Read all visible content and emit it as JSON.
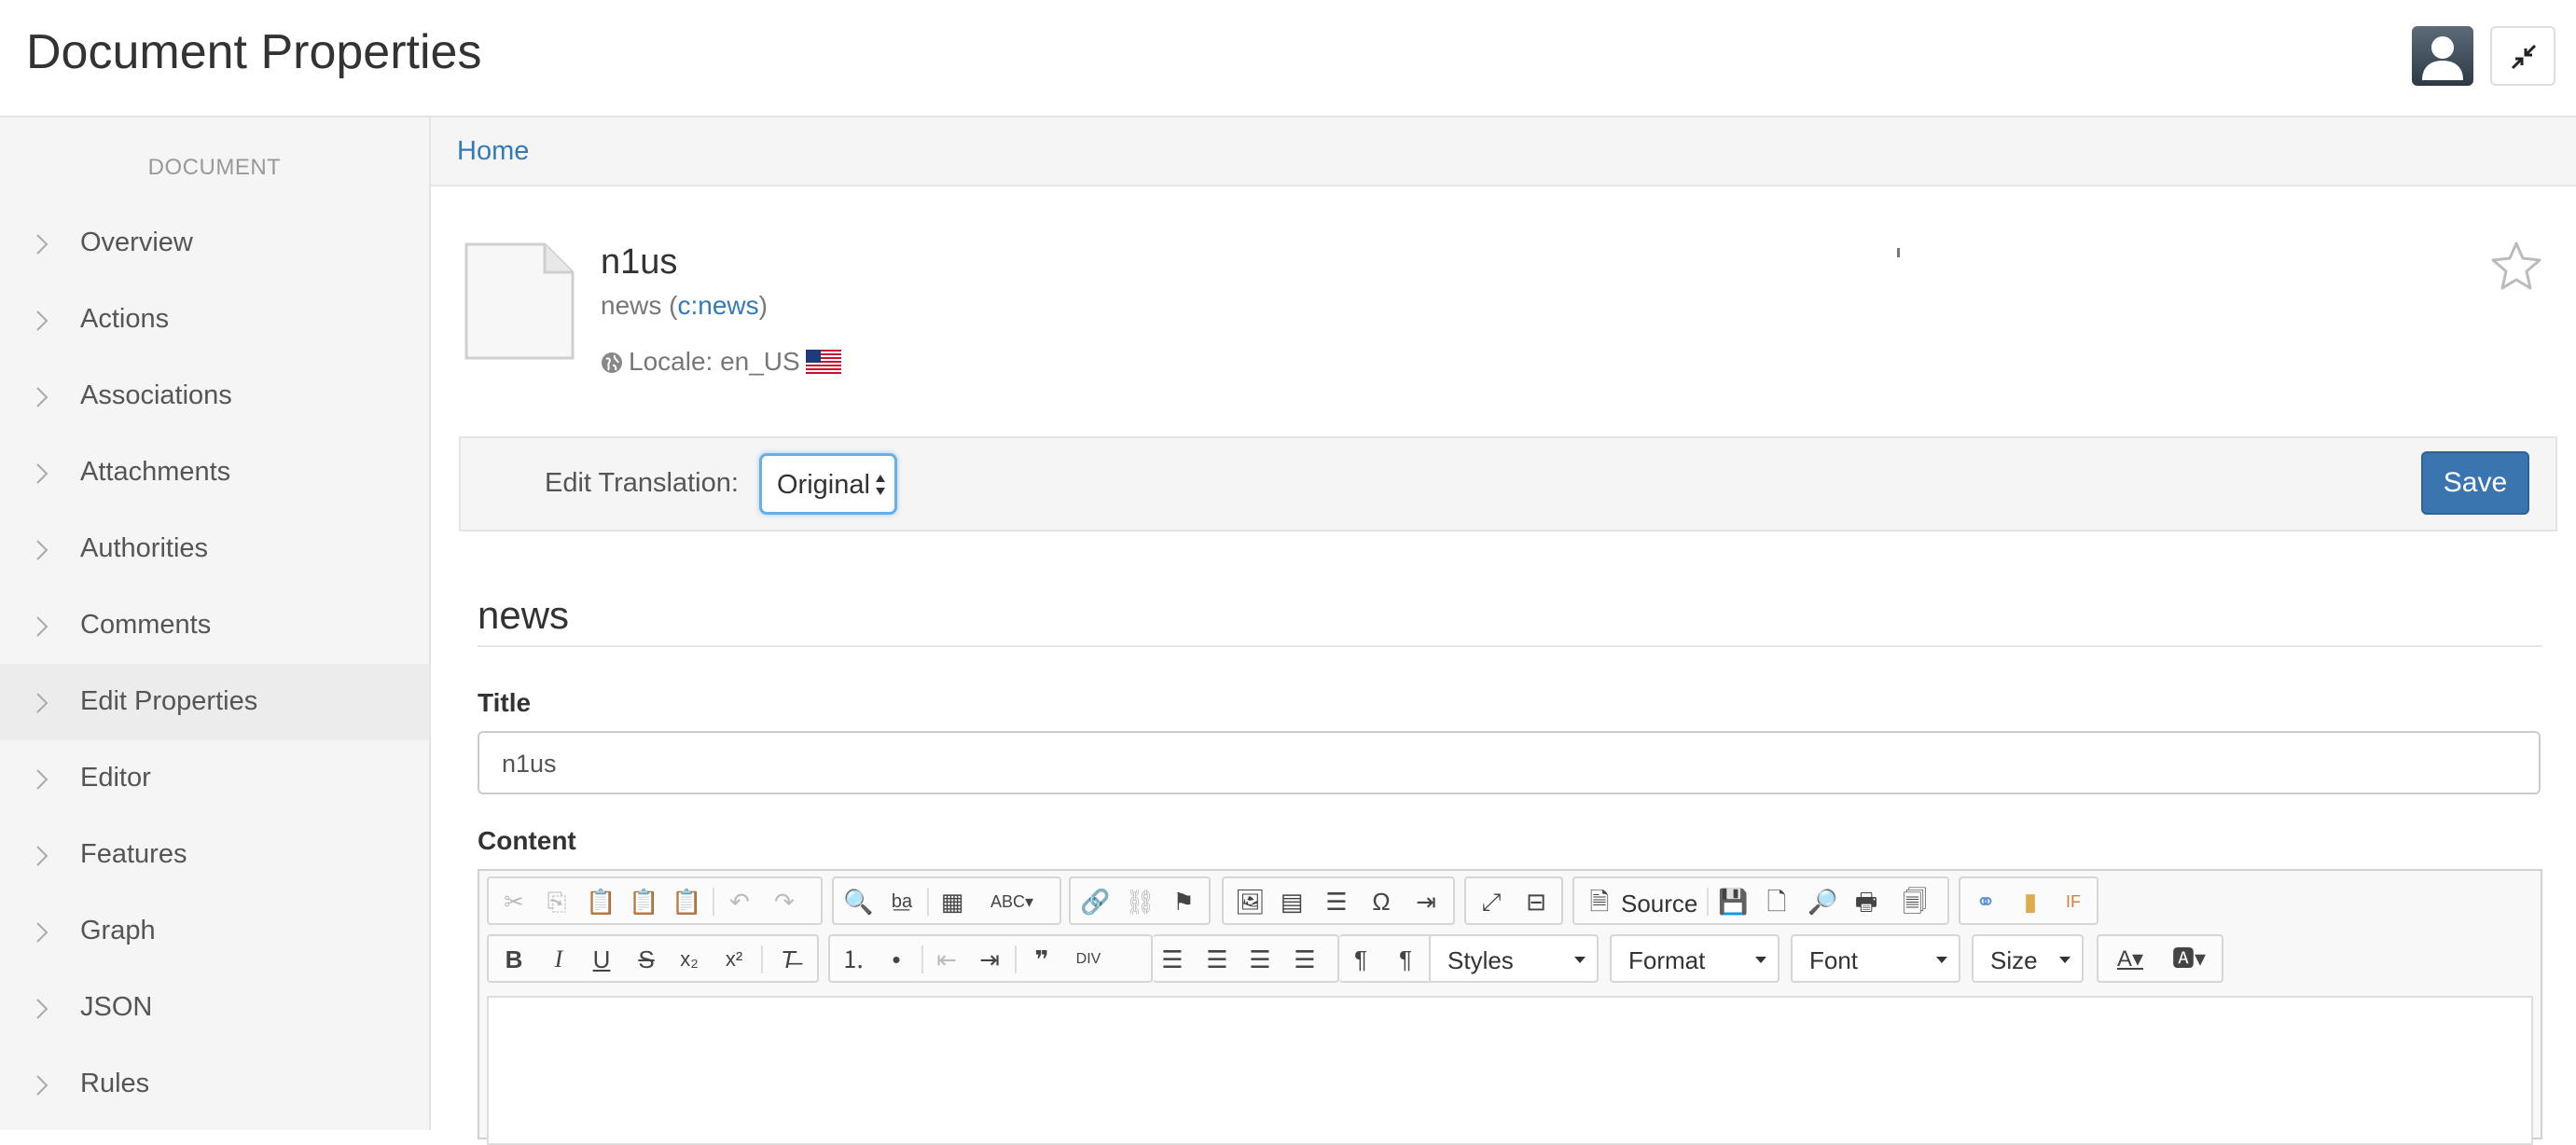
{
  "header": {
    "title": "Document Properties"
  },
  "sidebar": {
    "heading": "DOCUMENT",
    "items": [
      {
        "label": "Overview"
      },
      {
        "label": "Actions"
      },
      {
        "label": "Associations"
      },
      {
        "label": "Attachments"
      },
      {
        "label": "Authorities"
      },
      {
        "label": "Comments"
      },
      {
        "label": "Edit Properties",
        "active": true
      },
      {
        "label": "Editor"
      },
      {
        "label": "Features"
      },
      {
        "label": "Graph"
      },
      {
        "label": "JSON"
      },
      {
        "label": "Rules"
      }
    ]
  },
  "breadcrumb": {
    "home": "Home"
  },
  "doc": {
    "name": "n1us",
    "type_prefix": "news (",
    "type_link": "c:news",
    "type_suffix": ")",
    "locale": "Locale: en_US"
  },
  "translation": {
    "label": "Edit Translation:",
    "selected": "Original",
    "save_label": "Save"
  },
  "form": {
    "section_title": "news",
    "title_label": "Title",
    "title_value": "n1us",
    "content_label": "Content"
  },
  "editor": {
    "source_label": "Source",
    "combos": {
      "styles": "Styles",
      "format": "Format",
      "font": "Font",
      "size": "Size"
    }
  },
  "colors": {
    "accent": "#337ab7",
    "save": "#3a75b0",
    "focus": "#66afe9"
  }
}
